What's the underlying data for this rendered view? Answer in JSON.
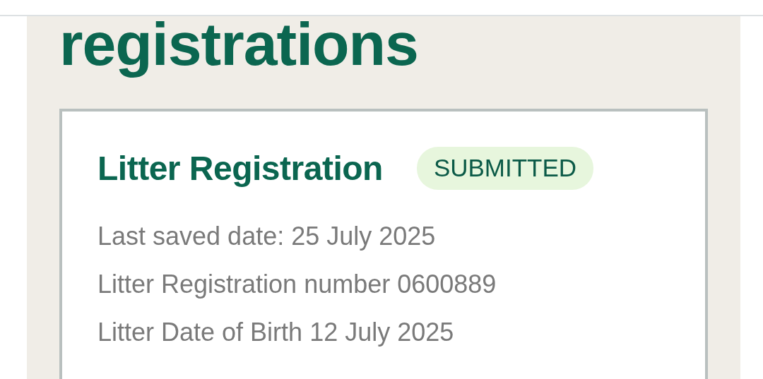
{
  "page_heading": "registrations",
  "card": {
    "title": "Litter Registration",
    "status": {
      "label": "SUBMITTED",
      "kind": "submitted"
    },
    "details": [
      "Last saved date: 25 July 2025",
      "Litter Registration number 0600889",
      "Litter Date of Birth 12 July 2025"
    ]
  }
}
